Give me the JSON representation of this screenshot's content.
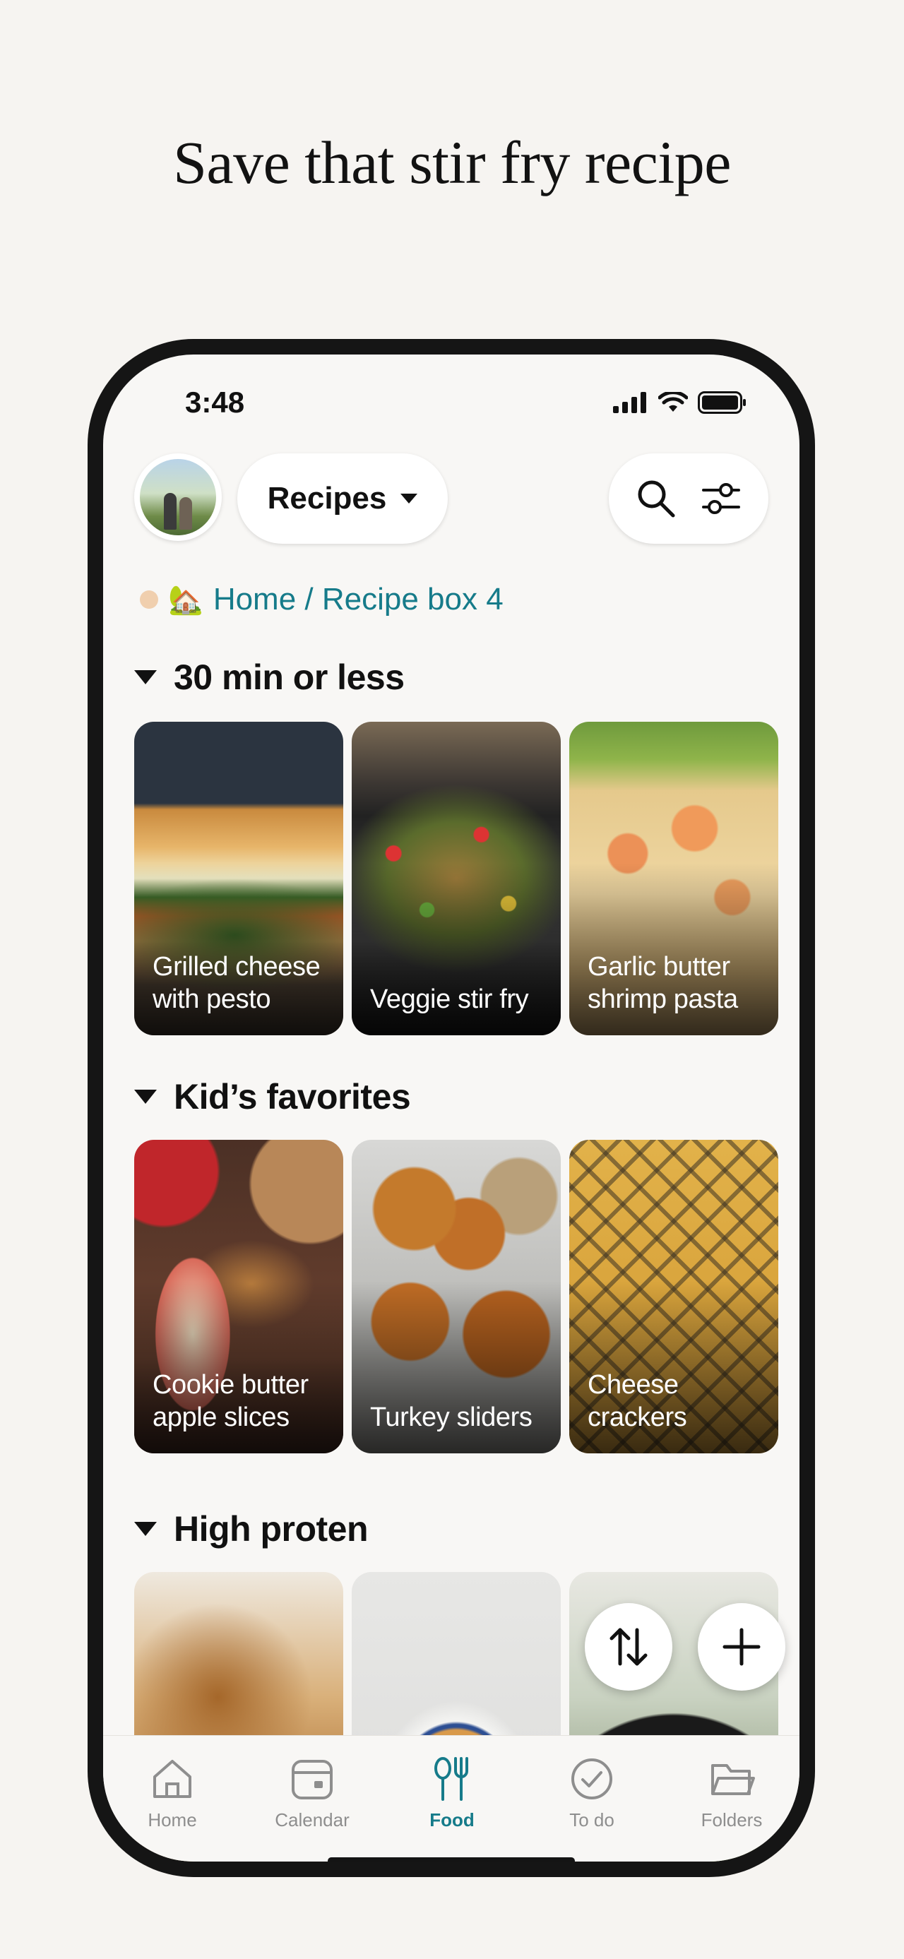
{
  "headline": "Save that stir fry recipe",
  "status_bar": {
    "time": "3:48"
  },
  "header": {
    "dropdown_label": "Recipes"
  },
  "breadcrumb": {
    "emoji": "🏡",
    "path": "Home / Recipe box 4"
  },
  "sections": [
    {
      "title": "30 min or less",
      "cards": [
        {
          "label_line1": "Grilled cheese",
          "label_line2": "with pesto"
        },
        {
          "label_line1": "",
          "label_line2": "Veggie stir fry"
        },
        {
          "label_line1": "Garlic butter",
          "label_line2": "shrimp pasta"
        }
      ]
    },
    {
      "title": "Kid’s favorites",
      "cards": [
        {
          "label_line1": "Cookie butter",
          "label_line2": "apple slices"
        },
        {
          "label_line1": "",
          "label_line2": "Turkey sliders"
        },
        {
          "label_line1": "Cheese",
          "label_line2": "crackers"
        }
      ]
    },
    {
      "title": "High proten",
      "cards": [
        {
          "label_line1": "",
          "label_line2": ""
        },
        {
          "label_line1": "",
          "label_line2": ""
        },
        {
          "label_line1": "",
          "label_line2": ""
        }
      ]
    }
  ],
  "tabbar": {
    "items": [
      {
        "label": "Home",
        "icon": "home-icon"
      },
      {
        "label": "Calendar",
        "icon": "calendar-icon"
      },
      {
        "label": "Food",
        "icon": "fork-knife-icon",
        "active": true
      },
      {
        "label": "To do",
        "icon": "check-circle-icon"
      },
      {
        "label": "Folders",
        "icon": "folder-icon"
      }
    ]
  },
  "colors": {
    "accent": "#167b8a",
    "background": "#f6f4f1",
    "phone_frame": "#151515"
  }
}
